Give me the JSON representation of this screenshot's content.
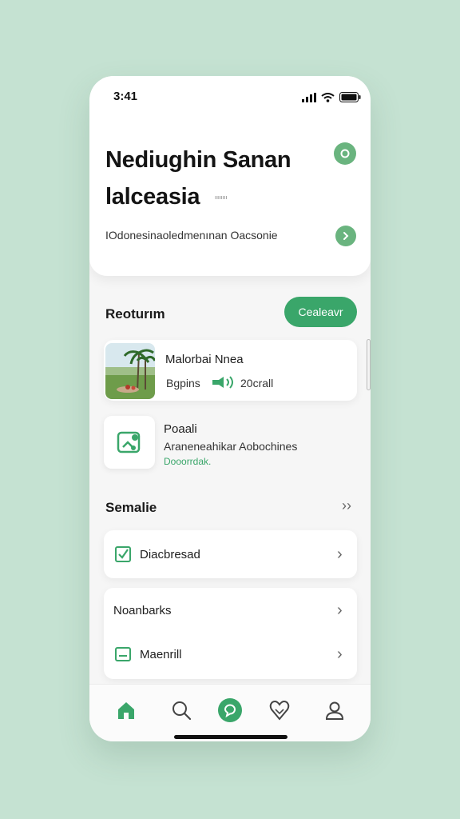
{
  "status": {
    "time": "3:41"
  },
  "header": {
    "title_line1": "Nediughin Sanan",
    "title_line2": "lalceasia",
    "title_note": "ıııııııı",
    "subtitle": "IOdonesinaoledmenınan Oacsonie"
  },
  "section1": {
    "title": "Reoturım",
    "button_label": "Cealeavr"
  },
  "items": [
    {
      "title": "Malorbai Nnea",
      "meta": "Bgpins",
      "meta2": "20crall"
    },
    {
      "title": "Poaali",
      "desc": "Araneneahikar Aobochines",
      "status": "Dooorrdak."
    }
  ],
  "section2": {
    "title": "Semalie",
    "more": "››"
  },
  "list": [
    {
      "label": "Diacbresad"
    },
    {
      "label": "Noanbarks"
    },
    {
      "label": "Maenrill"
    }
  ],
  "tabs": [
    "Home",
    "Search",
    "Chat",
    "Favorites",
    "Profile"
  ],
  "colors": {
    "accent": "#3aa66a",
    "accent_light": "#6ab47f",
    "background": "#c5e2d2"
  }
}
